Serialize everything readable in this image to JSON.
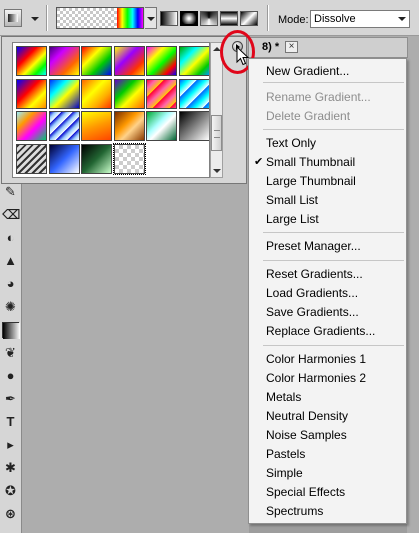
{
  "options_bar": {
    "mode_label": "Mode:",
    "mode_value": "Dissolve"
  },
  "document_tab": {
    "title_fragment": "8) *",
    "close_glyph": "×"
  },
  "gradient_picker": {
    "swatch_rows": [
      [
        "spectrum-diagonal",
        "violet-orange",
        "red-green-blue",
        "yellow-violet-orange",
        "rainbow-diagonal",
        "green-blue-stripe"
      ],
      [
        "blue-red-yellow",
        "blue-yellow-blue",
        "orange-yellow-orange",
        "violet-green-orange",
        "red-pink-stripe",
        "blue-cyan-stripe"
      ],
      [
        "transparent-rainbow",
        "blue-stripe-white",
        "yellow-orange",
        "copper",
        "chrome-green",
        "black-white"
      ],
      [
        "hatched-silver",
        "navy-blue",
        "black-green",
        "transparent-checker"
      ]
    ]
  },
  "menu": {
    "items": [
      {
        "label": "New Gradient...",
        "disabled": false,
        "checked": false
      },
      {
        "label": "Rename Gradient...",
        "disabled": true,
        "checked": false
      },
      {
        "label": "Delete Gradient",
        "disabled": true,
        "checked": false
      },
      {
        "label": "Text Only",
        "disabled": false,
        "checked": false
      },
      {
        "label": "Small Thumbnail",
        "disabled": false,
        "checked": true
      },
      {
        "label": "Large Thumbnail",
        "disabled": false,
        "checked": false
      },
      {
        "label": "Small List",
        "disabled": false,
        "checked": false
      },
      {
        "label": "Large List",
        "disabled": false,
        "checked": false
      },
      {
        "label": "Preset Manager...",
        "disabled": false,
        "checked": false
      },
      {
        "label": "Reset Gradients...",
        "disabled": false,
        "checked": false
      },
      {
        "label": "Load Gradients...",
        "disabled": false,
        "checked": false
      },
      {
        "label": "Save Gradients...",
        "disabled": false,
        "checked": false
      },
      {
        "label": "Replace Gradients...",
        "disabled": false,
        "checked": false
      },
      {
        "label": "Color Harmonies 1",
        "disabled": false,
        "checked": false
      },
      {
        "label": "Color Harmonies 2",
        "disabled": false,
        "checked": false
      },
      {
        "label": "Metals",
        "disabled": false,
        "checked": false
      },
      {
        "label": "Neutral Density",
        "disabled": false,
        "checked": false
      },
      {
        "label": "Noise Samples",
        "disabled": false,
        "checked": false
      },
      {
        "label": "Pastels",
        "disabled": false,
        "checked": false
      },
      {
        "label": "Simple",
        "disabled": false,
        "checked": false
      },
      {
        "label": "Special Effects",
        "disabled": false,
        "checked": false
      },
      {
        "label": "Spectrums",
        "disabled": false,
        "checked": false
      }
    ],
    "check_glyph": "✔"
  },
  "toolbar": {
    "tools": [
      "brush-icon",
      "eraser-icon",
      "bucket-icon",
      "stamp-icon",
      "smudge-icon",
      "sponge-icon",
      "gradient-icon",
      "burn-icon",
      "dodge-icon",
      "pen-icon",
      "type-icon",
      "path-select-icon",
      "shape-icon",
      "3d-rotate-icon",
      "3d-orbit-icon"
    ],
    "type_glyph": "T"
  },
  "colors": {
    "highlight_ring": "#e0061a",
    "menu_bg": "#f3f3f3",
    "disabled_text": "#8d8d8d"
  }
}
